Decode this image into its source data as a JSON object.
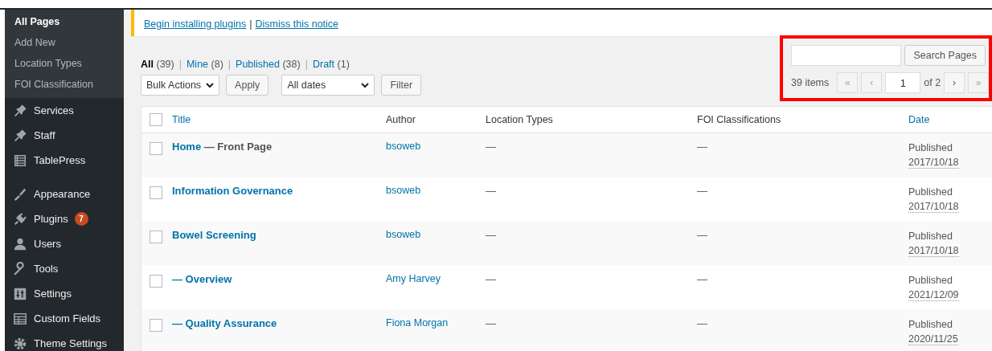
{
  "sidebar": {
    "submenu": [
      {
        "label": "All Pages",
        "selected": true
      },
      {
        "label": "Add New",
        "selected": false
      },
      {
        "label": "Location Types",
        "selected": false
      },
      {
        "label": "FOI Classification",
        "selected": false
      }
    ],
    "menu_groups": [
      [
        {
          "label": "Services"
        },
        {
          "label": "Staff"
        },
        {
          "label": "TablePress"
        }
      ],
      [
        {
          "label": "Appearance"
        },
        {
          "label": "Plugins",
          "badge": "7"
        },
        {
          "label": "Users"
        },
        {
          "label": "Tools"
        },
        {
          "label": "Settings"
        },
        {
          "label": "Custom Fields"
        },
        {
          "label": "Theme Settings"
        }
      ]
    ]
  },
  "notice": {
    "links": [
      "Begin installing plugins",
      "Dismiss this notice"
    ],
    "separator": "|"
  },
  "views": [
    {
      "label": "All",
      "count": "(39)",
      "selected": true
    },
    {
      "label": "Mine",
      "count": "(8)",
      "selected": false
    },
    {
      "label": "Published",
      "count": "(38)",
      "selected": false
    },
    {
      "label": "Draft",
      "count": "(1)",
      "selected": false
    }
  ],
  "bulk_actions": {
    "value": "Bulk Actions",
    "button": "Apply"
  },
  "date_filter": {
    "value": "All dates",
    "button": "Filter"
  },
  "views_separator": "|",
  "search": {
    "button": "Search Pages"
  },
  "pagination": {
    "count": "39 items",
    "first": {
      "label": "«",
      "disabled": true
    },
    "prev": {
      "label": "‹",
      "disabled": true
    },
    "page": "1",
    "of": "of 2",
    "next": {
      "label": "›",
      "disabled": false
    },
    "last": {
      "label": "»",
      "disabled": true
    }
  },
  "table": {
    "columns": [
      {
        "label": "Title",
        "sortable": true
      },
      {
        "label": "Author",
        "sortable": false
      },
      {
        "label": "Location Types",
        "sortable": false
      },
      {
        "label": "FOI Classifications",
        "sortable": false
      },
      {
        "label": "Date",
        "sortable": true
      }
    ],
    "header_checked": false,
    "rows": [
      {
        "checked": false,
        "title": "Home",
        "suffix": "— Front Page",
        "author": "bsoweb",
        "location": "—",
        "foi": "—",
        "status": "Published",
        "date": "2017/10/18"
      },
      {
        "checked": false,
        "title": "Information Governance",
        "author": "bsoweb",
        "location": "—",
        "foi": "—",
        "status": "Published",
        "date": "2017/10/18"
      },
      {
        "checked": false,
        "title": "Bowel Screening",
        "author": "bsoweb",
        "location": "—",
        "foi": "—",
        "status": "Published",
        "date": "2017/10/18"
      },
      {
        "checked": false,
        "title": "— Overview",
        "author": "Amy Harvey",
        "location": "—",
        "foi": "—",
        "status": "Published",
        "date": "2021/12/09"
      },
      {
        "checked": false,
        "title": "— Quality Assurance",
        "author": "Fiona Morgan",
        "location": "—",
        "foi": "—",
        "status": "Published",
        "date": "2020/11/25"
      }
    ]
  }
}
